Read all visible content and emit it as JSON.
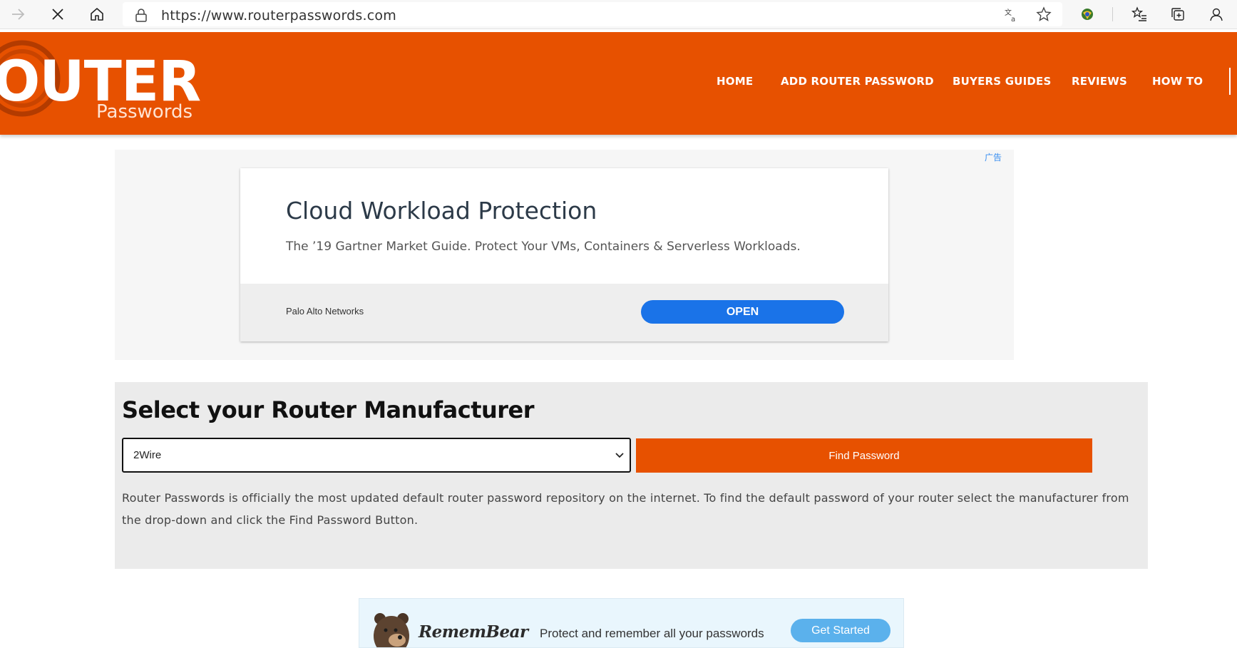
{
  "browser": {
    "url": "https://www.routerpasswords.com",
    "icons": [
      "back-arrow-icon",
      "stop-icon",
      "home-icon",
      "lock-icon",
      "translate-icon",
      "star-icon",
      "extension-icon",
      "favorites-icon",
      "collections-icon",
      "profile-icon"
    ]
  },
  "header": {
    "logo_main": "OUTER",
    "logo_sub": "Passwords",
    "nav": [
      "HOME",
      "ADD ROUTER PASSWORD",
      "BUYERS GUIDES",
      "REVIEWS",
      "HOW TO"
    ]
  },
  "ad1": {
    "tag": "广告",
    "title": "Cloud Workload Protection",
    "description": "The ’19 Gartner Market Guide. Protect Your VMs, Containers & Serverless Workloads.",
    "advertiser": "Palo Alto Networks",
    "cta": "OPEN"
  },
  "selector": {
    "title": "Select your Router Manufacturer",
    "selected": "2Wire",
    "button": "Find Password",
    "description": "Router Passwords is officially the most updated default router password repository on the internet. To find the default password of your router select the manufacturer from the drop-down and click the Find Password Button."
  },
  "ad2": {
    "brand": "RememBear",
    "tagline": "Protect and remember all your passwords",
    "cta": "Get Started"
  },
  "colors": {
    "brand_orange": "#e75100",
    "ad_blue": "#1a73e8",
    "remembear_blue": "#5bb1ec"
  }
}
